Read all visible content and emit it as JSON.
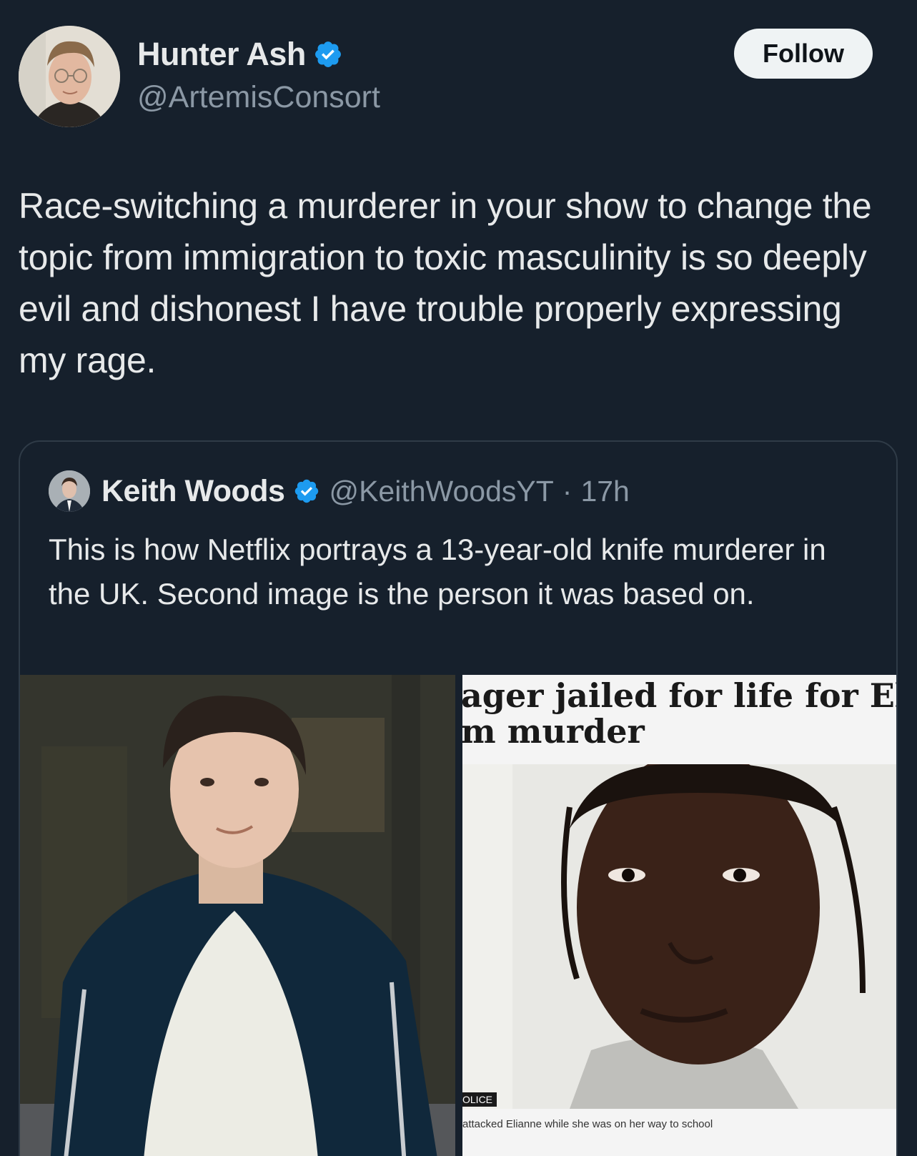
{
  "author": {
    "name": "Hunter Ash",
    "handle": "@ArtemisConsort",
    "verified": true
  },
  "follow_label": "Follow",
  "tweet_text": "Race-switching a murderer in your show to change the topic from immigration to toxic masculinity is so deeply evil and dishonest I have trouble properly expressing my rage.",
  "quoted": {
    "name": "Keith Woods",
    "handle": "@KeithWoodsYT",
    "time": "17h",
    "verified": true,
    "text": "This is how Netflix portrays a 13-year-old knife murderer in the UK. Second image is the person it was based on."
  },
  "news_image": {
    "headline_line1": "ager jailed for life for Eliann",
    "headline_line2": "m murder",
    "police_label": "OLICE",
    "caption": "attacked Elianne while she was on her way to school"
  },
  "colors": {
    "background": "#16202c",
    "verified_blue": "#1d9bf0",
    "muted_text": "#8b98a5",
    "text": "#e7e9ea"
  }
}
